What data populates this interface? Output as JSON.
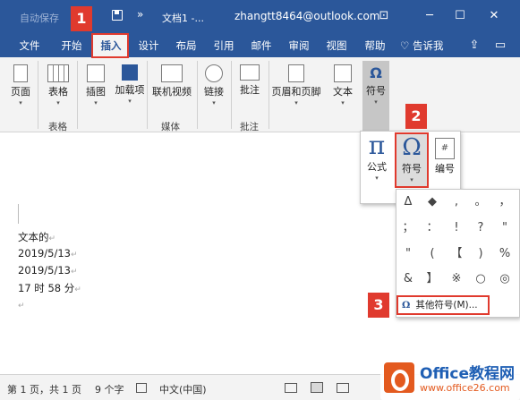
{
  "titlebar": {
    "autosave": "自动保存",
    "save_icon": "save-icon",
    "more": "»",
    "doc_title": "文档1 -...",
    "account": "zhangtt8464@outlook.com",
    "ribbon_opts": "⊡",
    "minimize": "─",
    "maximize": "☐",
    "close": "✕"
  },
  "menu": {
    "tabs": [
      "文件",
      "开始",
      "插入",
      "设计",
      "布局",
      "引用",
      "邮件",
      "审阅",
      "视图",
      "帮助"
    ],
    "active": "插入",
    "tellme": "告诉我"
  },
  "ribbon": {
    "page": "页面",
    "table": "表格",
    "pictures": "插图",
    "addins": "加载项",
    "onlinevideo": "联机视频",
    "link": "链接",
    "comment": "批注",
    "headerfooter": "页眉和页脚",
    "text": "文本",
    "symbols": "符号",
    "groups": {
      "table": "表格",
      "media": "媒体",
      "comments": "批注"
    }
  },
  "doc": {
    "lines": [
      "文本的",
      "2019/5/13",
      "2019/5/13",
      "17 时 58 分"
    ],
    "para_mark": "↵"
  },
  "symbols_dropdown": {
    "equation": "公式",
    "symbol": "符号",
    "number": "编号"
  },
  "symbol_grid": [
    "Δ",
    "◆",
    ",",
    "。",
    "，",
    "；",
    "：",
    "!",
    "?",
    "\"",
    "\"",
    "(",
    "【",
    ")",
    "%",
    "&",
    "】",
    "※",
    "○",
    "◎"
  ],
  "more_symbols": "其他符号(M)...",
  "steps": [
    "1",
    "2",
    "3"
  ],
  "status": {
    "page": "第 1 页，共 1 页",
    "words": "9 个字",
    "lang": "中文(中国)"
  },
  "watermark": {
    "brand": "Office教程网",
    "url": "www.office26.com"
  }
}
